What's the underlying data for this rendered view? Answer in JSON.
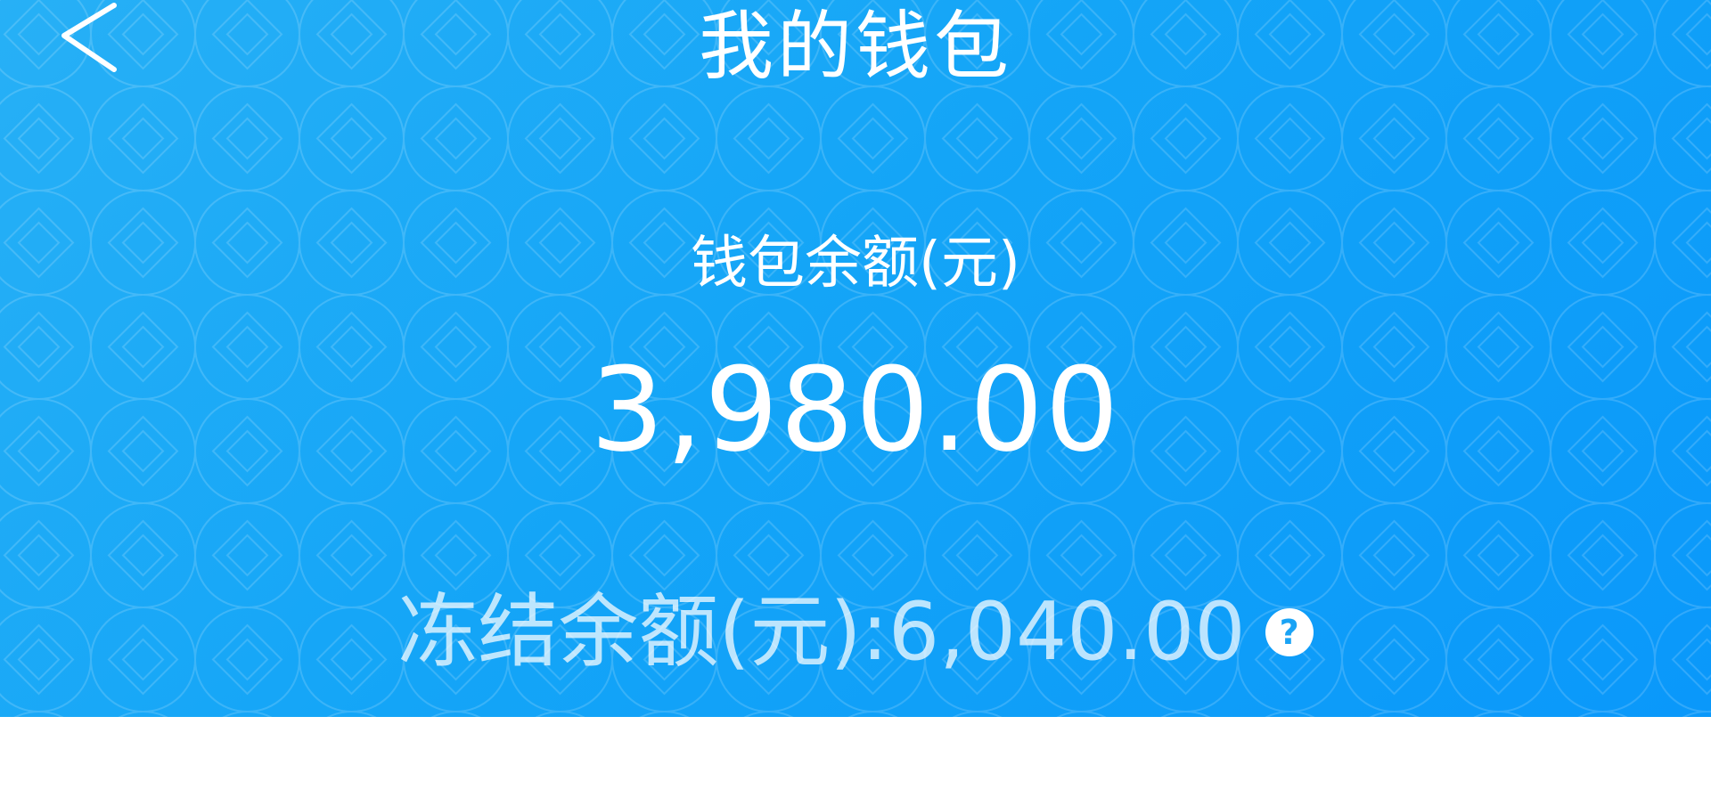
{
  "header": {
    "title": "我的钱包",
    "back_icon": "chevron-left-icon"
  },
  "wallet": {
    "balance_label": "钱包余额(元)",
    "balance_amount": "3,980.00",
    "frozen_text": "冻结余额(元):6,040.00",
    "help_icon": "question-mark-icon",
    "help_glyph": "?"
  },
  "colors": {
    "hero_gradient_start": "#27b0f6",
    "hero_gradient_end": "#0a98fa",
    "text": "#ffffff",
    "page_background": "#ffffff"
  }
}
